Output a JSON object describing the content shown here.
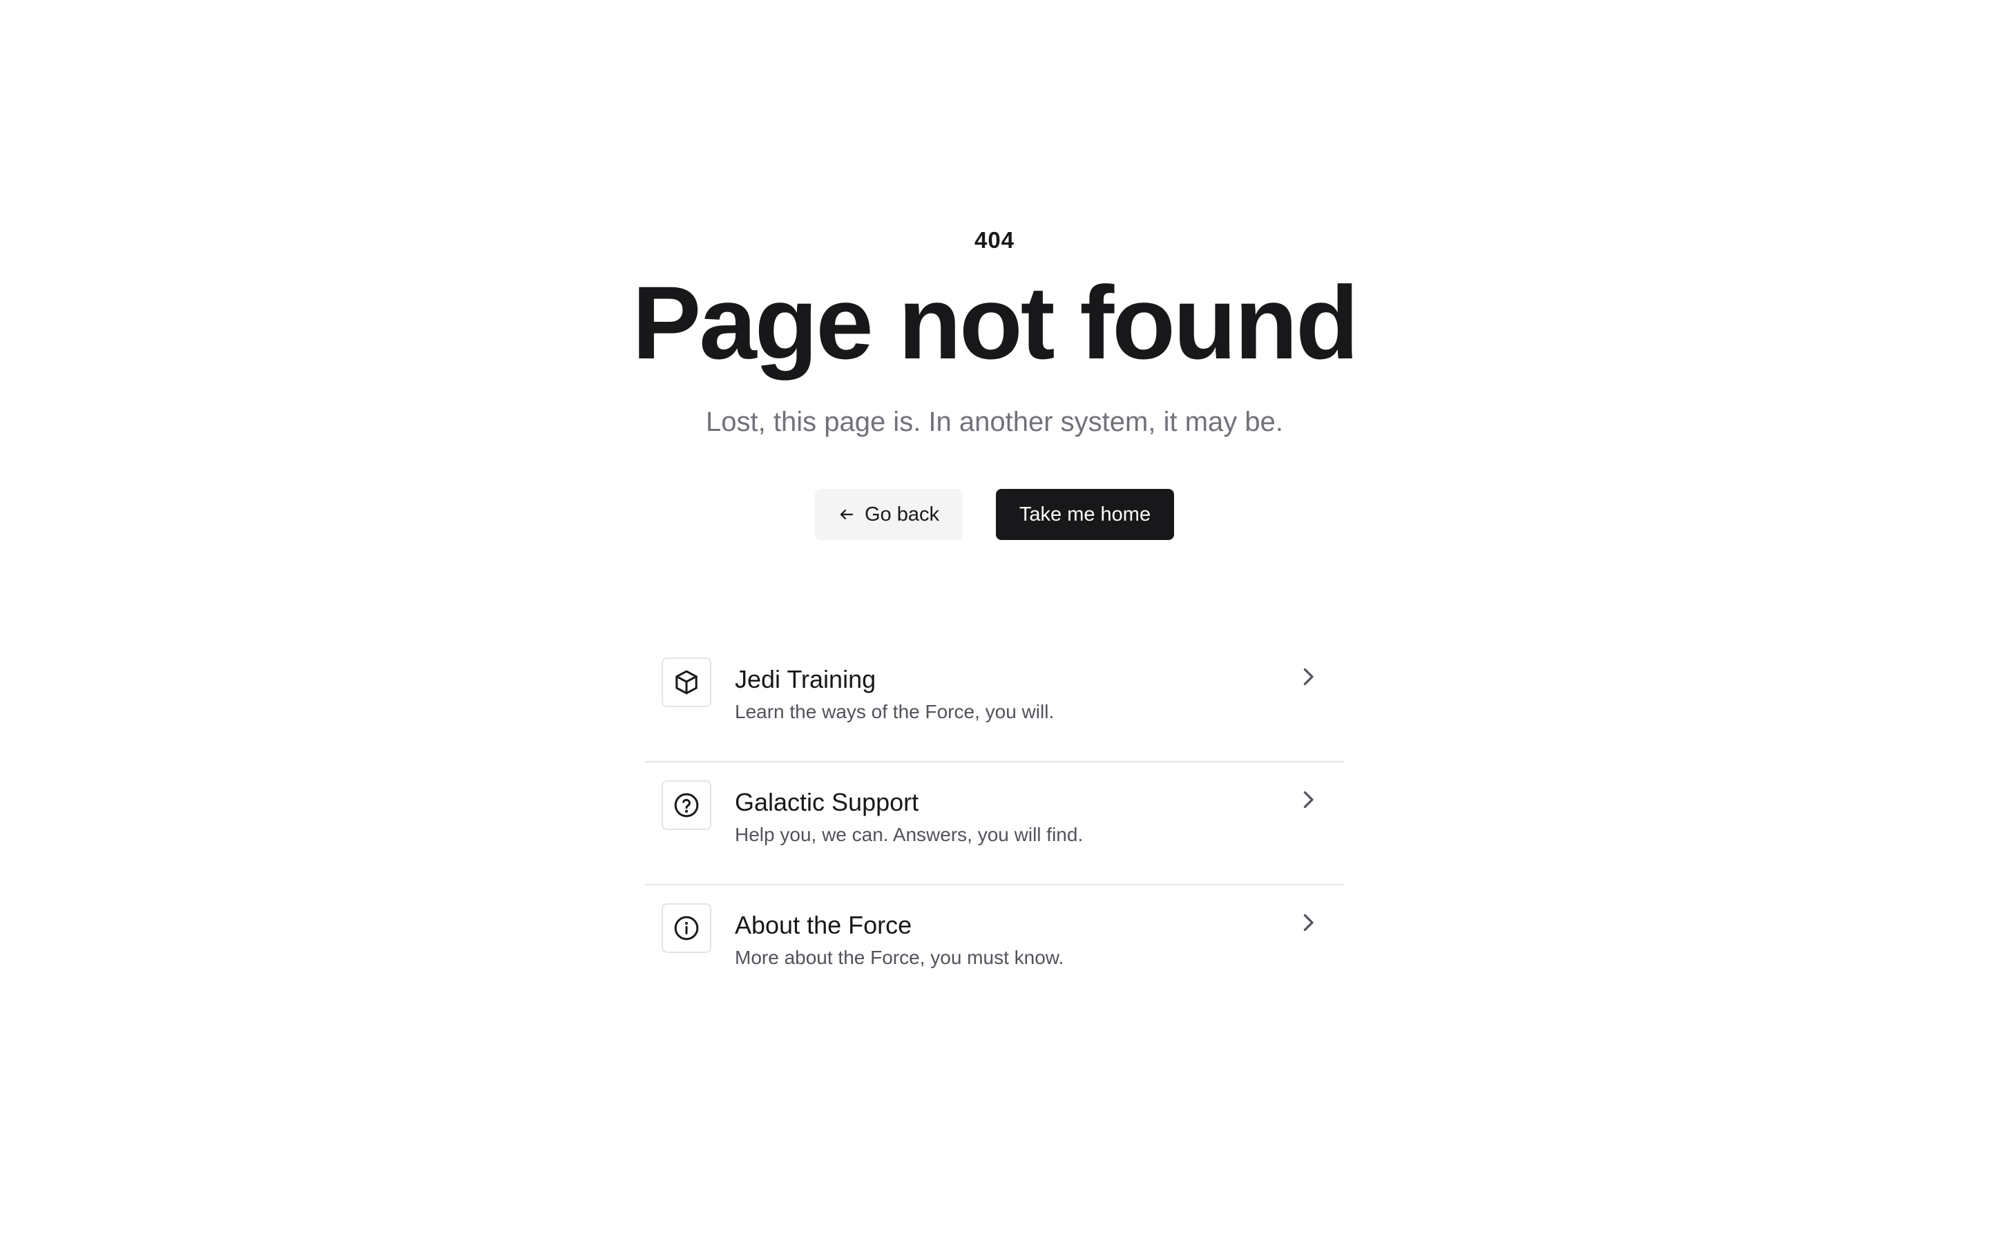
{
  "error": {
    "code": "404",
    "title": "Page not found",
    "subtitle": "Lost, this page is. In another system, it may be."
  },
  "actions": {
    "back_label": "Go back",
    "back_icon": "arrow-left-icon",
    "home_label": "Take me home"
  },
  "links": [
    {
      "icon": "cube-icon",
      "title": "Jedi Training",
      "description": "Learn the ways of the Force, you will."
    },
    {
      "icon": "help-circle-icon",
      "title": "Galactic Support",
      "description": "Help you, we can. Answers, you will find."
    },
    {
      "icon": "info-circle-icon",
      "title": "About the Force",
      "description": "More about the Force, you must know."
    }
  ],
  "colors": {
    "text_primary": "#18181b",
    "text_muted": "#71717a",
    "button_secondary_bg": "#f4f4f5",
    "button_primary_bg": "#18181b",
    "border": "#e4e4e7"
  }
}
